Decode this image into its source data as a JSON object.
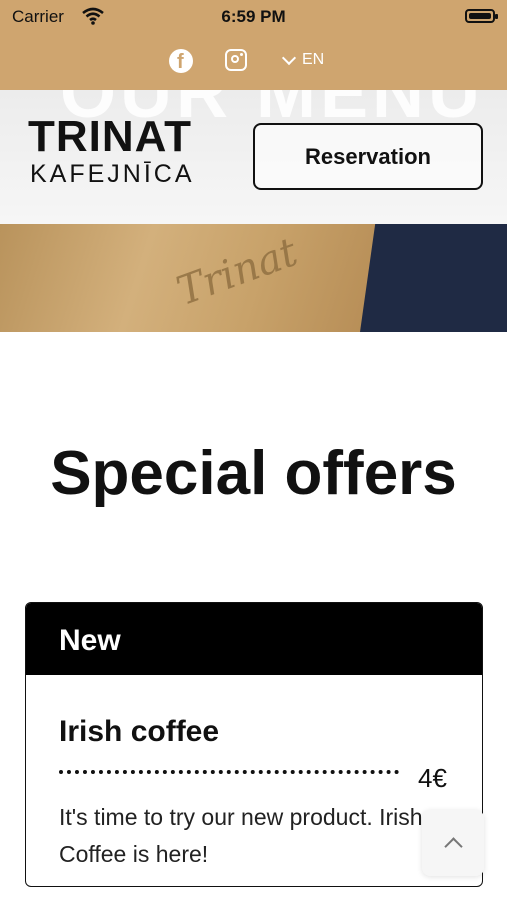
{
  "status_bar": {
    "carrier": "Carrier",
    "time": "6:59 PM"
  },
  "social": {
    "language": "EN"
  },
  "header": {
    "logo_line1": "TRINAT",
    "logo_line2": "KAFEJNĪCA",
    "reservation_label": "Reservation",
    "background_text": "OUR MENU"
  },
  "section_title": "Special offers",
  "offer": {
    "badge": "New",
    "name": "Irish coffee",
    "price": "4€",
    "description": "It's time to try our new product. Irish Coffee is here!"
  },
  "colors": {
    "accent": "#cfa56f",
    "text": "#111111",
    "card_header": "#000000"
  }
}
